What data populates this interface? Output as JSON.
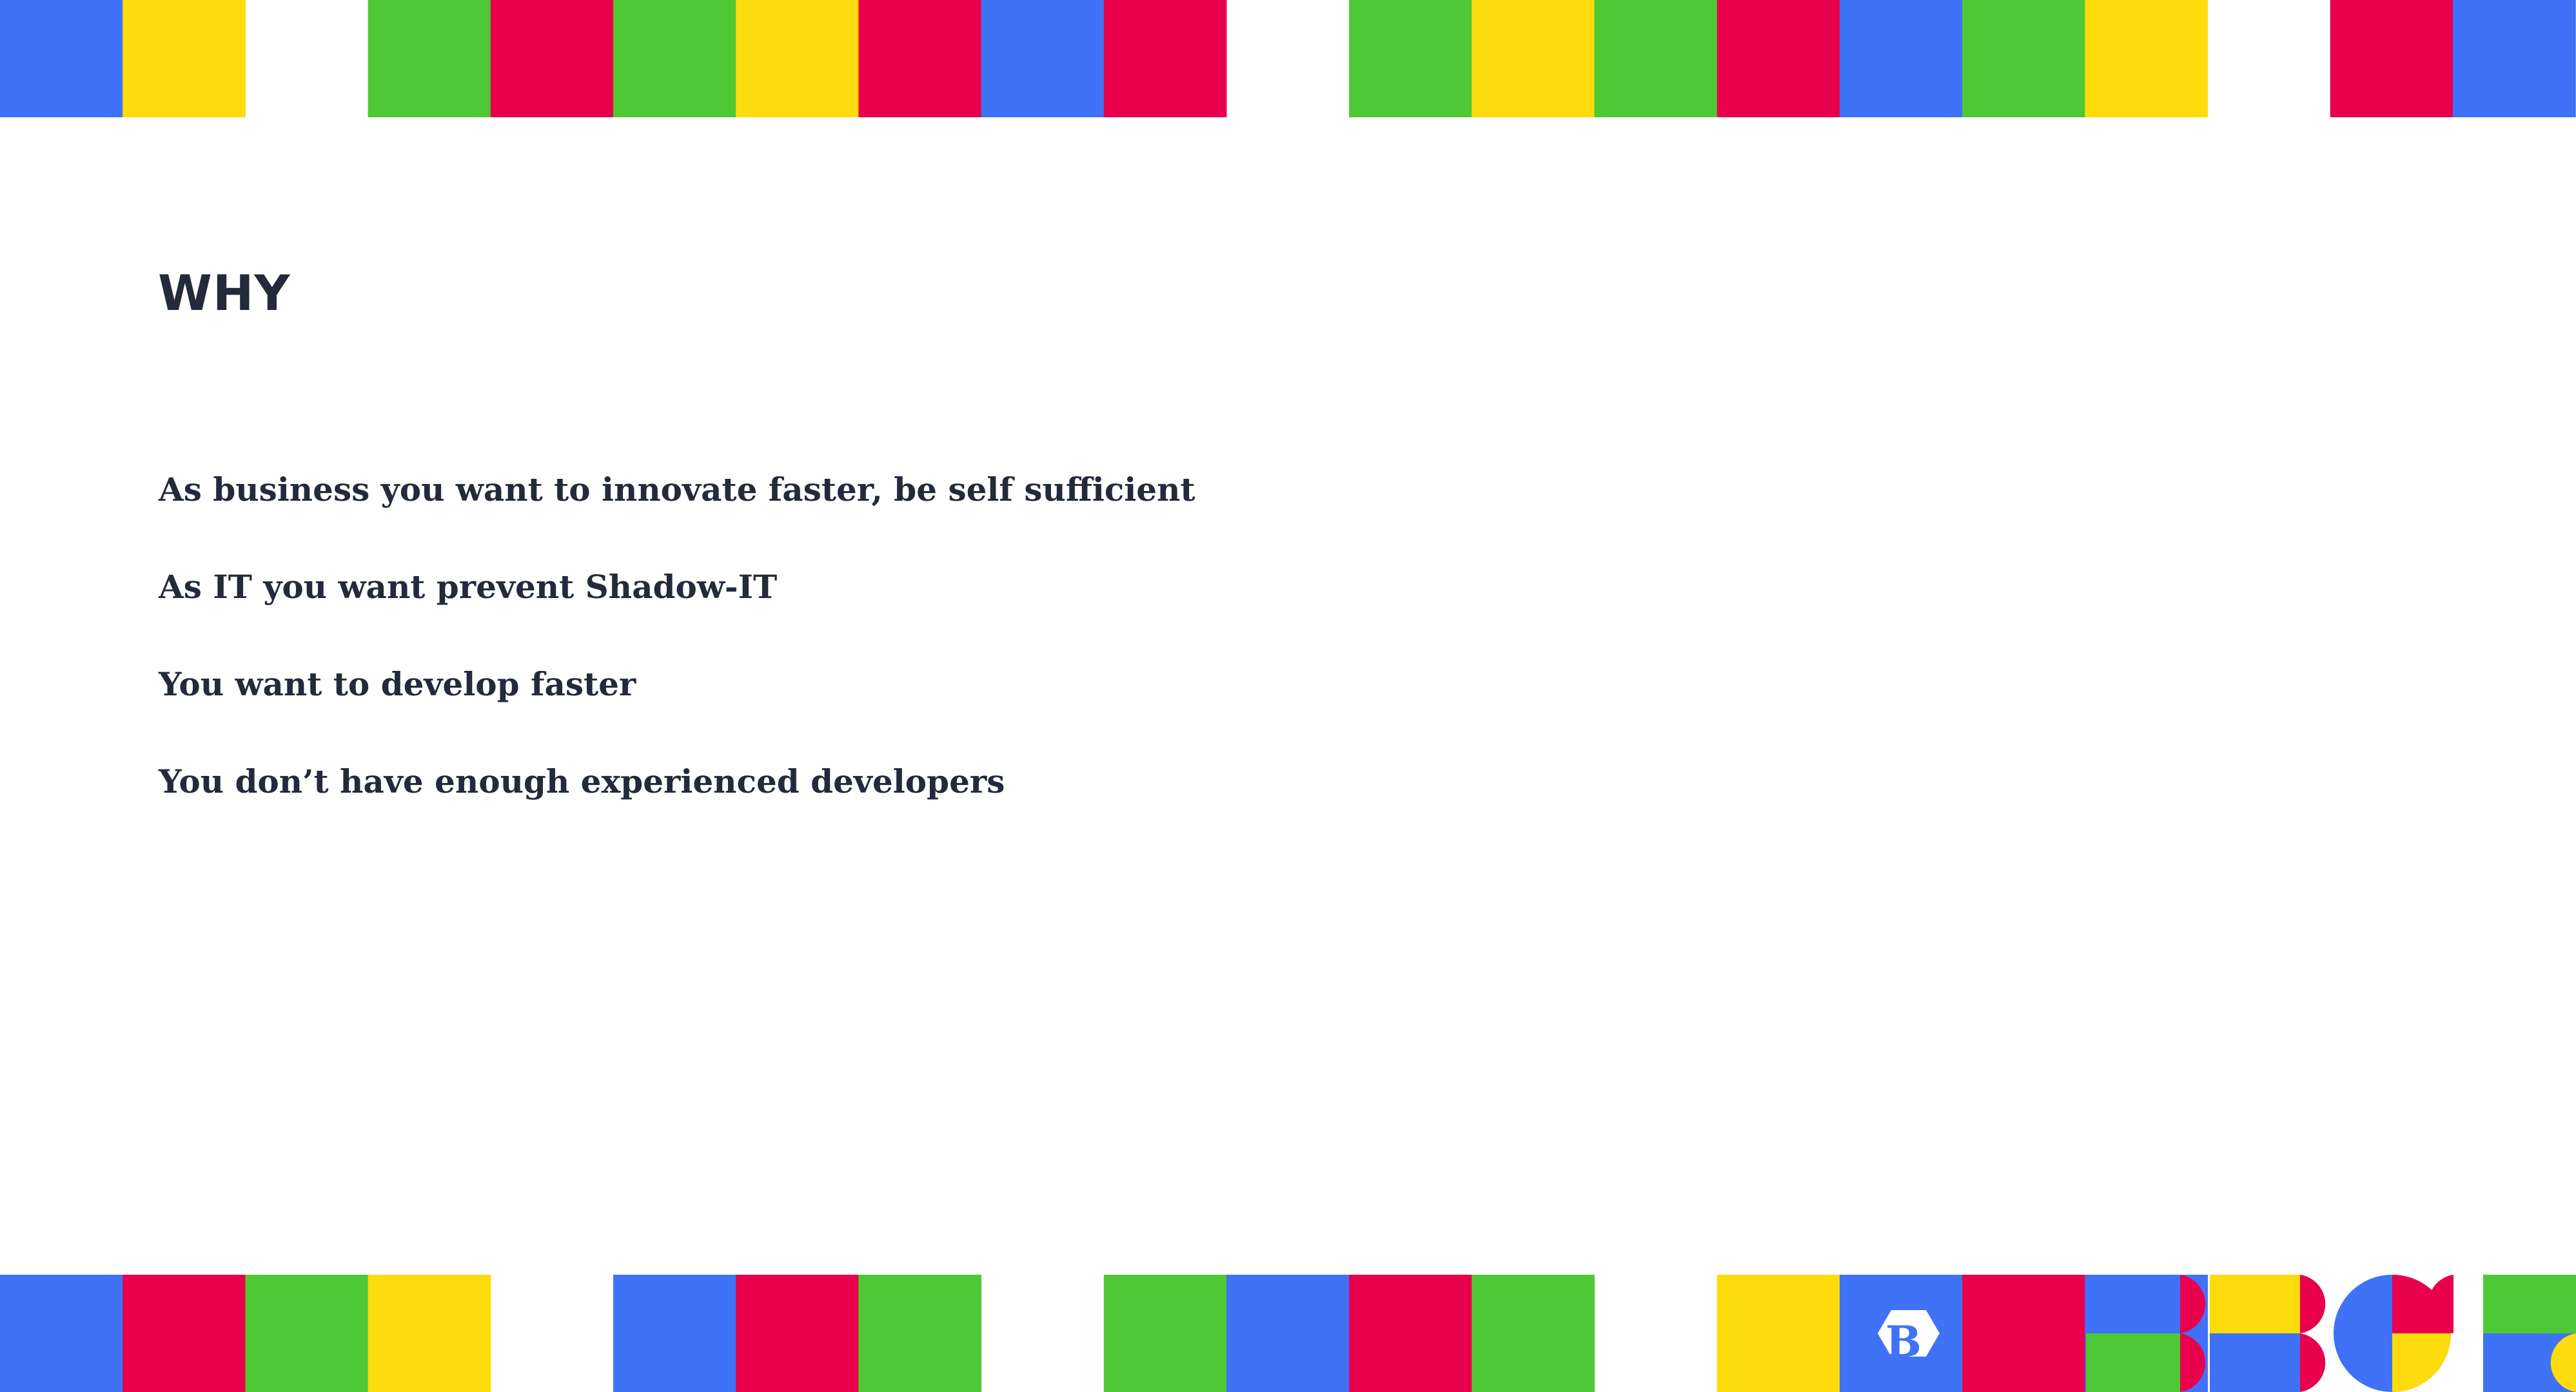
{
  "slide": {
    "title": "WHY",
    "bullets": [
      "As business you want to innovate faster, be self sufficient",
      "As IT you want prevent Shadow-IT",
      "You want to develop faster",
      "You don’t have enough experienced developers"
    ]
  },
  "brand": {
    "logo_letter": "B"
  },
  "palette": {
    "blue": "#3f72f6",
    "yellow": "#fedb0c",
    "green": "#4ec834",
    "red": "#e9004d",
    "text": "#232a3b"
  },
  "decor": {
    "top_band": [
      "blue",
      "yellow",
      "white",
      "green",
      "red",
      "green",
      "yellow",
      "red",
      "blue",
      "red",
      "white",
      "green",
      "yellow",
      "green",
      "red",
      "blue",
      "green",
      "yellow",
      "white",
      "red",
      "blue"
    ],
    "bottom_band": [
      "blue",
      "red",
      "green",
      "yellow",
      "white",
      "blue",
      "red",
      "green",
      "white",
      "green",
      "blue",
      "red",
      "green",
      "white",
      "yellow",
      "logo",
      "red",
      "blue"
    ]
  }
}
